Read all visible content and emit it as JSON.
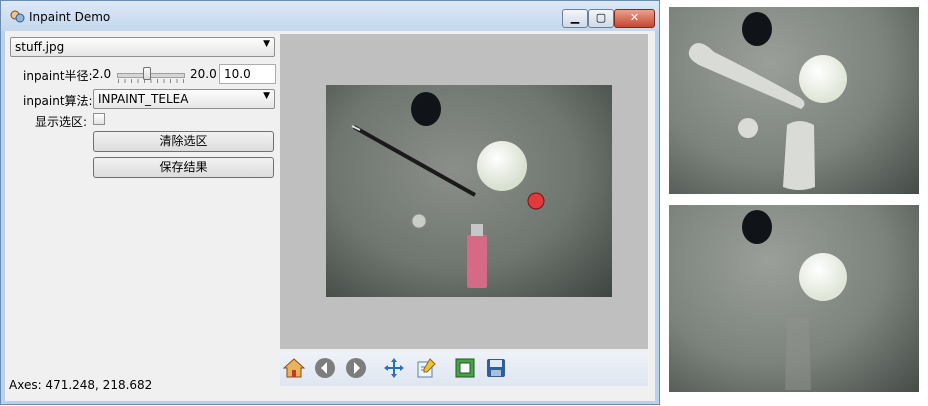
{
  "window": {
    "title": "Inpaint Demo"
  },
  "left_panel": {
    "file_select": {
      "value": "stuff.jpg"
    },
    "radius": {
      "label": "inpaint半径:",
      "min": "2.0",
      "max": "20.0",
      "value": "10.0",
      "slider_fraction": 0.44
    },
    "method": {
      "label": "inpaint算法:",
      "value": "INPAINT_TELEA"
    },
    "show_selection": {
      "label": "显示选区:",
      "checked": false
    },
    "clear_button": "清除选区",
    "save_button": "保存结果"
  },
  "status": {
    "text": "Axes: 471.248, 218.682"
  },
  "toolbar": {
    "tools": [
      "home-icon",
      "back-icon",
      "forward-icon",
      "pan-icon",
      "edit-icon",
      "subplots-icon",
      "save-icon"
    ]
  },
  "colors": {
    "titlebar": "#c4d7ee",
    "figure_bg": "#bfbfbf",
    "close_button": "#c5472e",
    "marker": "#e03a3a"
  }
}
